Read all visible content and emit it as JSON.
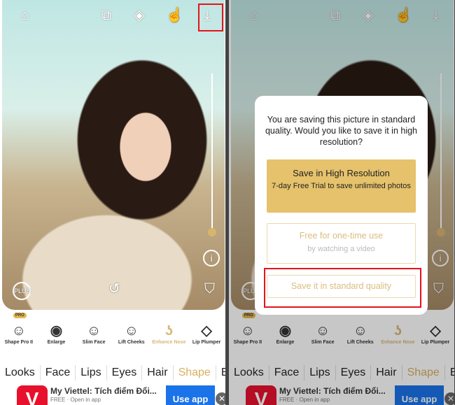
{
  "top_icons": [
    "home-icon",
    "photo-switch-icon",
    "compare-icon",
    "touch-icon",
    "download-icon"
  ],
  "tools": [
    {
      "label": "Shape Pro II",
      "icon": "face-pro-icon",
      "badge": "PRO"
    },
    {
      "label": "Enlarge",
      "icon": "eye-enlarge-icon"
    },
    {
      "label": "Slim Face",
      "icon": "slim-face-icon"
    },
    {
      "label": "Lift Cheeks",
      "icon": "lift-cheeks-icon"
    },
    {
      "label": "Enhance Nose",
      "icon": "nose-icon",
      "active": true
    },
    {
      "label": "Lip Plumper",
      "icon": "lips-icon"
    }
  ],
  "tabs": [
    {
      "label": "Looks"
    },
    {
      "label": "Face"
    },
    {
      "label": "Lips"
    },
    {
      "label": "Eyes"
    },
    {
      "label": "Hair"
    },
    {
      "label": "Shape",
      "active": true
    },
    {
      "label": "Edit"
    }
  ],
  "ad": {
    "logo": "V",
    "title": "My Viettel: Tích điểm Đổi...",
    "subtitle": "FREE · Open in app",
    "button": "Use app"
  },
  "controls": {
    "plus": "PLUS"
  },
  "dialog": {
    "message": "You are saving this picture in standard quality. Would you like to save it in high resolution?",
    "high_res_title": "Save in High Resolution",
    "high_res_sub": "7-day Free Trial to save unlimited photos",
    "one_time_title": "Free for one-time use",
    "one_time_sub": "by watching a video",
    "standard": "Save it in standard quality"
  },
  "colors": {
    "accent": "#e5c26b",
    "highlight": "#e8121a",
    "ad_button": "#1a73e8"
  }
}
